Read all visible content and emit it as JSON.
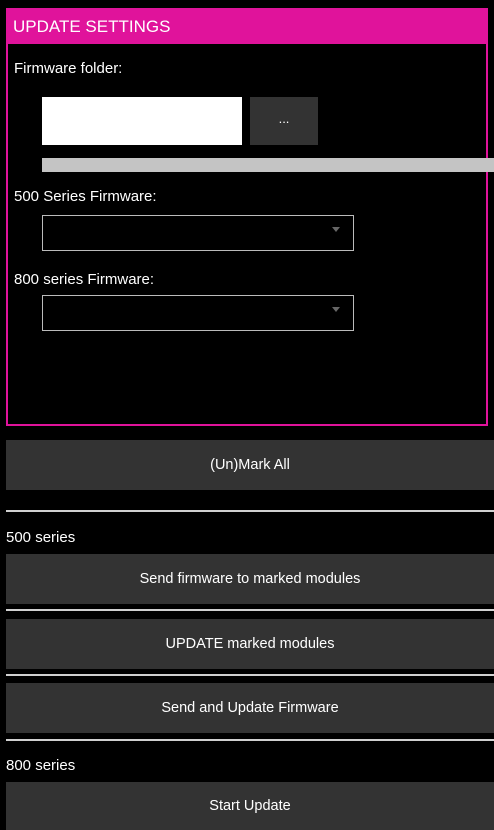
{
  "panel": {
    "title": "UPDATE SETTINGS",
    "firmware_folder_label": "Firmware folder:",
    "firmware_folder_value": "",
    "browse_label": "...",
    "progress_fraction": 1.0,
    "series500_label": "500 Series Firmware:",
    "series500_selected": "",
    "series800_label": "800 series Firmware:",
    "series800_selected": "",
    "accent_color": "#e0139b"
  },
  "actions": {
    "mark_all_label": "(Un)Mark All",
    "series500_section": "500 series",
    "send_firmware_label": "Send firmware to marked modules",
    "update_marked_label": "UPDATE marked modules",
    "send_and_update_label": "Send and Update Firmware",
    "series800_section": "800 series",
    "start_update_label": "Start Update"
  }
}
